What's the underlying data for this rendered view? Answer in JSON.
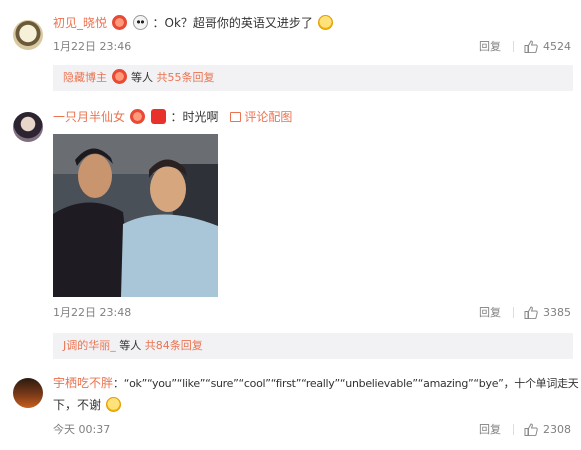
{
  "comments": [
    {
      "user": "初见_晓悦",
      "text": "：Ok？超哥你的英语又进步了",
      "time": "1月22日 23:46",
      "reply_label": "回复",
      "likes": "4524",
      "sub": {
        "user": "隐藏博主",
        "middle": "等人",
        "count": "共55条回复"
      }
    },
    {
      "user": "一只月半仙女",
      "text": "：时光啊",
      "pic_link": "评论配图",
      "time": "1月22日 23:48",
      "reply_label": "回复",
      "likes": "3385",
      "sub": {
        "user": "J调的华丽_",
        "middle": "等人",
        "count": "共84条回复"
      }
    },
    {
      "user": "宇栖吃不胖",
      "text_line1": "：“ok”“you”“like”“sure”“cool”“first”“really”“unbelievable”“amazing”“bye”，十个单词走天",
      "text_line2": "下，不谢",
      "time": "今天 00:37",
      "reply_label": "回复",
      "likes": "2308"
    }
  ],
  "icons": {
    "like": "thumbs-up-icon",
    "emoji_cat": "yellow-face-emoji",
    "emoji_heart": "heart-eyes-emoji",
    "emoji_panda": "panda-emoji",
    "emoji_redbox": "red-envelope-emoji"
  },
  "colors": {
    "username": "#eb7350",
    "meta": "#808080",
    "sub_bg": "#f2f2f5"
  }
}
